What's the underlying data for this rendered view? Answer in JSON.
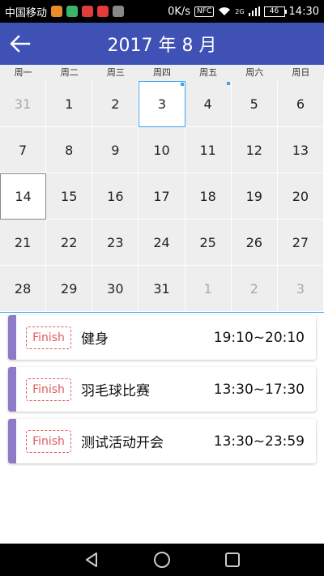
{
  "status_bar": {
    "carrier": "中国移动",
    "speed": "0K/s",
    "nfc": "NFC",
    "network": "2G",
    "battery": "46",
    "time": "14:30"
  },
  "header": {
    "title": "2017 年 8 月"
  },
  "weekdays": [
    "周一",
    "周二",
    "周三",
    "周四",
    "周五",
    "周六",
    "周日"
  ],
  "calendar": {
    "days": [
      "31",
      "1",
      "2",
      "3",
      "4",
      "5",
      "6",
      "7",
      "8",
      "9",
      "10",
      "11",
      "12",
      "13",
      "14",
      "15",
      "16",
      "17",
      "18",
      "19",
      "20",
      "21",
      "22",
      "23",
      "24",
      "25",
      "26",
      "27",
      "28",
      "29",
      "30",
      "31",
      "1",
      "2",
      "3"
    ]
  },
  "events": [
    {
      "status": "Finish",
      "title": "健身",
      "time": "19:10~20:10"
    },
    {
      "status": "Finish",
      "title": "羽毛球比赛",
      "time": "13:30~17:30"
    },
    {
      "status": "Finish",
      "title": "测试活动开会",
      "time": "13:30~23:59"
    }
  ],
  "colors": {
    "primary": "#3f51b5",
    "accent": "#3aa4f0",
    "event_stripe": "#8f7ac7",
    "finish_badge": "#e25a5a"
  }
}
